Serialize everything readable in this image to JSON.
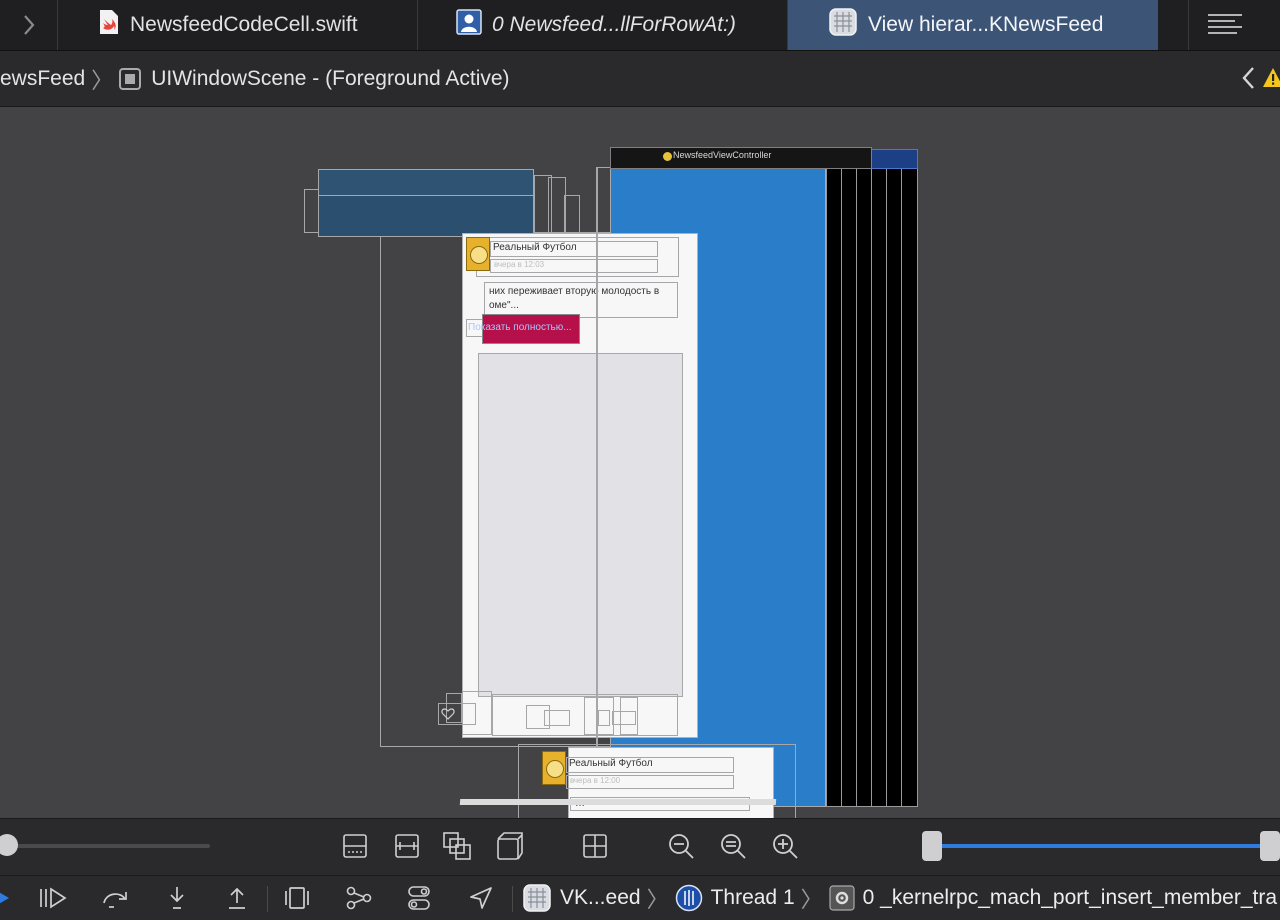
{
  "tabs": [
    {
      "label": "NewsfeedCodeCell.swift",
      "icon": "swift-file-icon"
    },
    {
      "label": "0 Newsfeed...llForRowAt:)",
      "icon": "stack-frame-icon"
    },
    {
      "label": "View hierar...KNewsFeed",
      "icon": "view-hierarchy-icon",
      "active": true
    }
  ],
  "jumpbar": {
    "project": "ewsFeed",
    "scene": "UIWindowScene - (Foreground Active)"
  },
  "canvas": {
    "controller_label": "NewsfeedViewController",
    "post1": {
      "author": "Реальный Футбол",
      "subtitle": "вчера в 12:03",
      "text_line1": "них переживает вторую молодость в",
      "text_line2": "оме\"...",
      "show_more": "Показать полностью..."
    },
    "post2": {
      "author": "Реальный Футбол",
      "subtitle": "вчера в 12:00",
      "text_line": "…"
    }
  },
  "toolbar": {
    "icons": [
      "clip-icon",
      "frames-icon",
      "layout-stack-icon",
      "3d-views-icon",
      "grid-icon",
      "zoom-out-icon",
      "zoom-actual-icon",
      "zoom-in-icon"
    ]
  },
  "debugbar": {
    "scheme": "VK...eed",
    "thread": "Thread 1",
    "frame": "0 _kernelrpc_mach_port_insert_member_tra"
  },
  "colors": {
    "accent": "#2a7ec9",
    "tab_active": "#3c5577",
    "pink": "#b5104a",
    "canvas_bg": "#434345"
  }
}
